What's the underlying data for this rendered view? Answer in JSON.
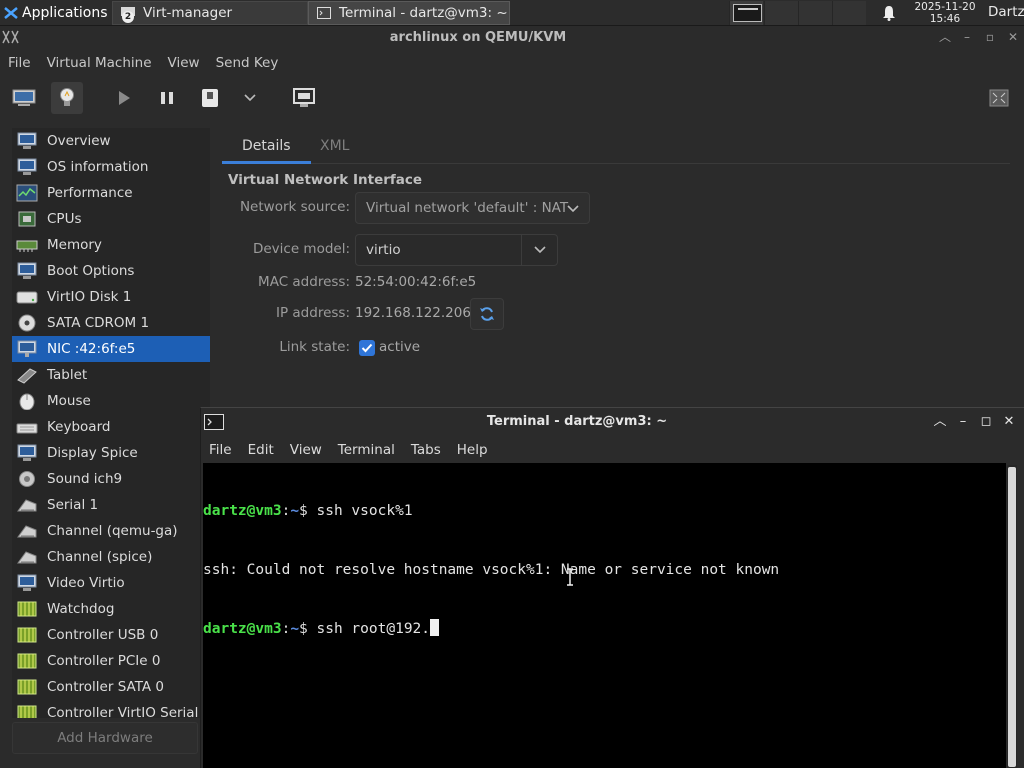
{
  "panel": {
    "applications_label": "Applications",
    "tasks": [
      {
        "label": "Virt-manager",
        "badge": "2"
      },
      {
        "label": "Terminal - dartz@vm3: ~"
      }
    ],
    "clock_date": "2025-11-20",
    "clock_time": "15:46",
    "user": "Dartz"
  },
  "virt_manager": {
    "title": "archlinux on QEMU/KVM",
    "menu": [
      "File",
      "Virtual Machine",
      "View",
      "Send Key"
    ],
    "toolbar": {
      "icons": [
        "console-icon",
        "details-lightbulb-icon",
        "run-icon",
        "pause-icon",
        "shutdown-icon",
        "chevron-down-icon",
        "snapshots-icon",
        "fullscreen-icon"
      ]
    },
    "hardware": [
      {
        "label": "Overview",
        "icon": "monitor-icon"
      },
      {
        "label": "OS information",
        "icon": "monitor-icon"
      },
      {
        "label": "Performance",
        "icon": "performance-icon"
      },
      {
        "label": "CPUs",
        "icon": "cpu-icon"
      },
      {
        "label": "Memory",
        "icon": "memory-icon"
      },
      {
        "label": "Boot Options",
        "icon": "monitor-icon"
      },
      {
        "label": "VirtIO Disk 1",
        "icon": "disk-icon"
      },
      {
        "label": "SATA CDROM 1",
        "icon": "cdrom-icon"
      },
      {
        "label": "NIC :42:6f:e5",
        "icon": "nic-icon",
        "selected": true
      },
      {
        "label": "Tablet",
        "icon": "tablet-icon"
      },
      {
        "label": "Mouse",
        "icon": "mouse-icon"
      },
      {
        "label": "Keyboard",
        "icon": "keyboard-icon"
      },
      {
        "label": "Display Spice",
        "icon": "monitor-icon"
      },
      {
        "label": "Sound ich9",
        "icon": "speaker-icon"
      },
      {
        "label": "Serial 1",
        "icon": "serial-icon"
      },
      {
        "label": "Channel (qemu-ga)",
        "icon": "serial-icon"
      },
      {
        "label": "Channel (spice)",
        "icon": "serial-icon"
      },
      {
        "label": "Video Virtio",
        "icon": "monitor-icon"
      },
      {
        "label": "Watchdog",
        "icon": "controller-icon"
      },
      {
        "label": "Controller USB 0",
        "icon": "controller-icon"
      },
      {
        "label": "Controller PCIe 0",
        "icon": "controller-icon"
      },
      {
        "label": "Controller SATA 0",
        "icon": "controller-icon"
      },
      {
        "label": "Controller VirtIO Serial",
        "icon": "controller-icon"
      }
    ],
    "add_hardware": "Add Hardware",
    "tabs": [
      "Details",
      "XML"
    ],
    "section_title": "Virtual Network Interface",
    "fields": {
      "network_source_label": "Network source:",
      "network_source_value": "Virtual network 'default' : NAT",
      "device_model_label": "Device model:",
      "device_model_value": "virtio",
      "mac_label": "MAC address:",
      "mac_value": "52:54:00:42:6f:e5",
      "ip_label": "IP address:",
      "ip_value": "192.168.122.206",
      "link_label": "Link state:",
      "link_value": "active",
      "link_checked": true
    }
  },
  "terminal": {
    "title": "Terminal - dartz@vm3: ~",
    "menu": [
      "File",
      "Edit",
      "View",
      "Terminal",
      "Tabs",
      "Help"
    ],
    "lines": [
      {
        "user": "dartz@vm3",
        "sep": ":",
        "path": "~",
        "prompt": "$ ",
        "cmd": "ssh vsock%1"
      },
      {
        "text": "ssh: Could not resolve hostname vsock%1: Name or service not known"
      },
      {
        "user": "dartz@vm3",
        "sep": ":",
        "path": "~",
        "prompt": "$ ",
        "cmd": "ssh root@192."
      }
    ]
  },
  "colors": {
    "selection": "#1d5fb5",
    "tab_accent": "#3b7fd9",
    "prompt_user": "#4ae24a",
    "prompt_path": "#5c8de0"
  }
}
